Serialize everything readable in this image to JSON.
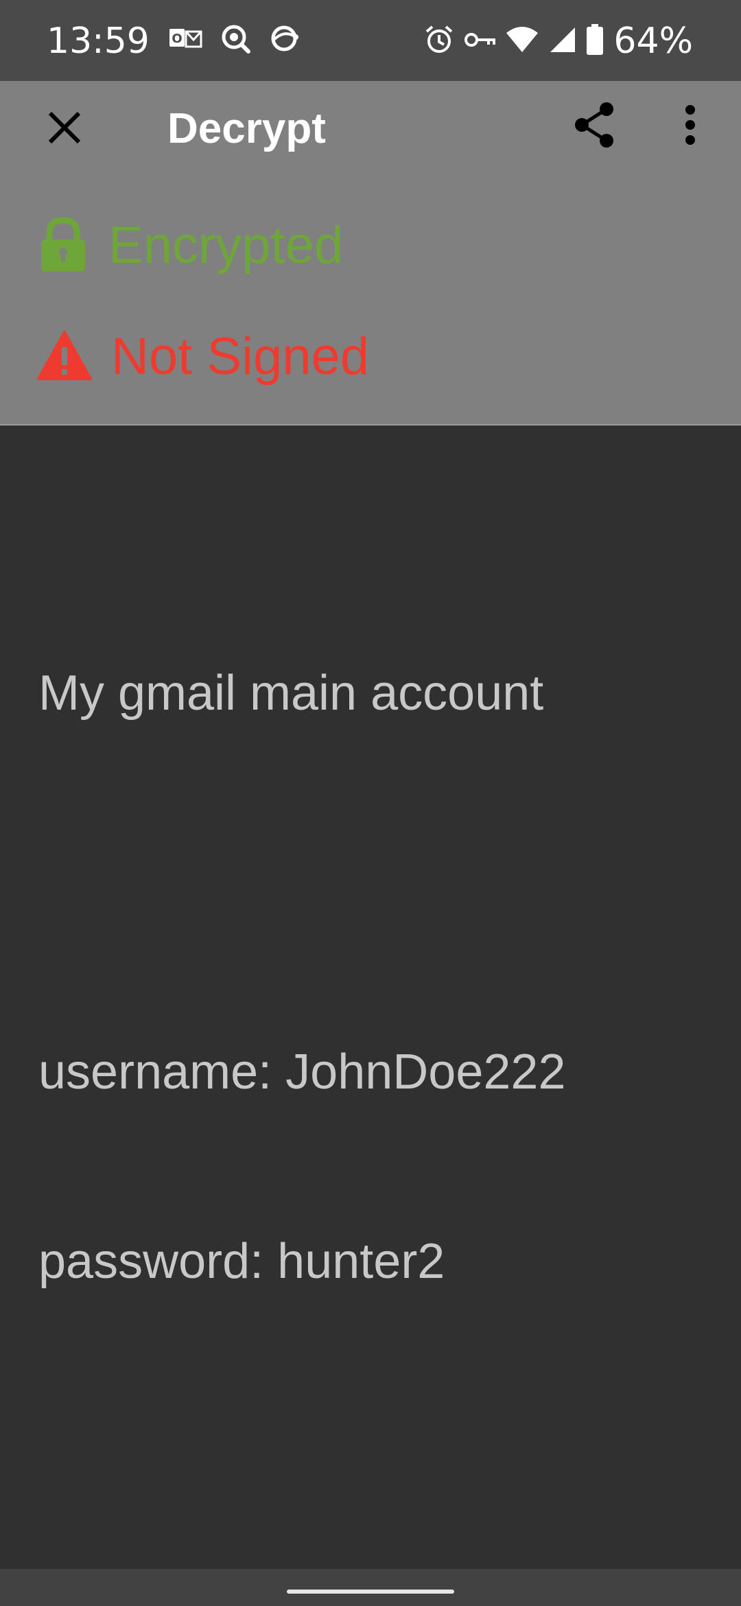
{
  "status_bar": {
    "time": "13:59",
    "battery_percent": "64%",
    "left_icons": [
      "outlook-icon",
      "search-notification-icon",
      "sync-notification-icon"
    ],
    "right_icons": [
      "alarm-icon",
      "vpn-key-icon",
      "wifi-icon",
      "cell-signal-icon",
      "battery-icon"
    ]
  },
  "toolbar": {
    "title": "Decrypt",
    "close_icon": "close-icon",
    "share_icon": "share-icon",
    "more_icon": "more-vert-icon",
    "background": "#808080"
  },
  "verification": {
    "encrypted_label": "Encrypted",
    "encrypted_color": "#6ea63a",
    "encrypted_icon": "lock-icon",
    "signed_label": "Not Signed",
    "signed_color": "#ef3b2f",
    "signed_icon": "warning-icon"
  },
  "message": {
    "line1": "My gmail main account",
    "line2": "username: JohnDoe222",
    "line3": "password: hunter2"
  }
}
